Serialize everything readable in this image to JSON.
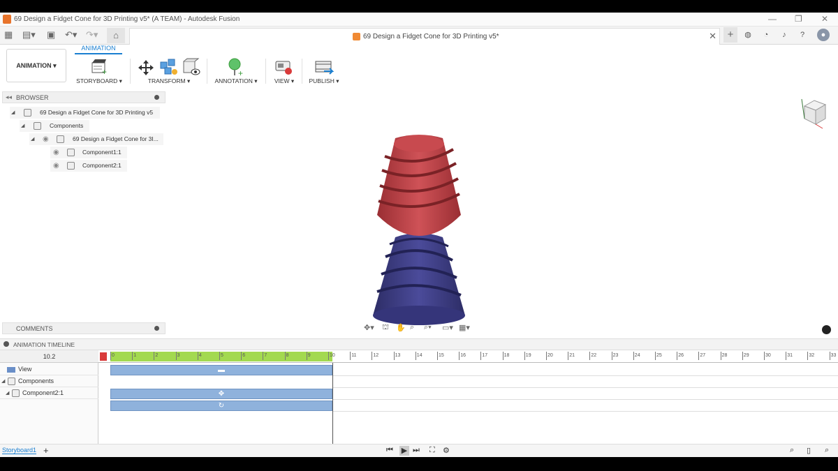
{
  "window": {
    "title": "69 Design a Fidget Cone for 3D Printing v5* (A TEAM) - Autodesk Fusion",
    "min_icon": "minimize-icon",
    "max_icon": "maximize-icon",
    "close_icon": "close-icon"
  },
  "tabbar": {
    "doc_title": "69 Design a Fidget Cone for 3D Printing v5*",
    "close_glyph": "✕",
    "add_glyph": "+"
  },
  "toolbar": {
    "workspace_label": "ANIMATION ▾",
    "active_tab": "ANIMATION",
    "groups": {
      "storyboard": "STORYBOARD ▾",
      "transform": "TRANSFORM ▾",
      "annotation": "ANNOTATION ▾",
      "view": "VIEW ▾",
      "publish": "PUBLISH ▾"
    }
  },
  "browser": {
    "title": "BROWSER",
    "items": [
      {
        "label": "69 Design a Fidget Cone for 3D Printing v5"
      },
      {
        "label": "Components"
      },
      {
        "label": "69 Design a Fidget Cone for 3I..."
      },
      {
        "label": "Component1:1"
      },
      {
        "label": "Component2:1"
      }
    ]
  },
  "comments": {
    "title": "COMMENTS"
  },
  "timeline": {
    "title": "ANIMATION TIMELINE",
    "current_time": "10.2",
    "rows": [
      {
        "label": "View"
      },
      {
        "label": "Components"
      },
      {
        "label": "Component2:1"
      }
    ],
    "ticks": [
      "0",
      "1",
      "2",
      "3",
      "4",
      "5",
      "6",
      "7",
      "8",
      "9",
      "10",
      "11",
      "12",
      "13",
      "14",
      "15",
      "16",
      "17",
      "18",
      "19",
      "20",
      "21",
      "22",
      "23",
      "24",
      "25",
      "26",
      "27",
      "28",
      "29",
      "30",
      "31",
      "32",
      "33"
    ]
  },
  "bottom": {
    "storyboard_tab": "Storyboard1",
    "add_glyph": "+"
  },
  "colors": {
    "accent": "#1a7fd1",
    "cone_top": "#c0464b",
    "cone_bottom": "#3d3d82",
    "timeline_green": "#a3d950",
    "track_blue": "#8fb2dc"
  }
}
